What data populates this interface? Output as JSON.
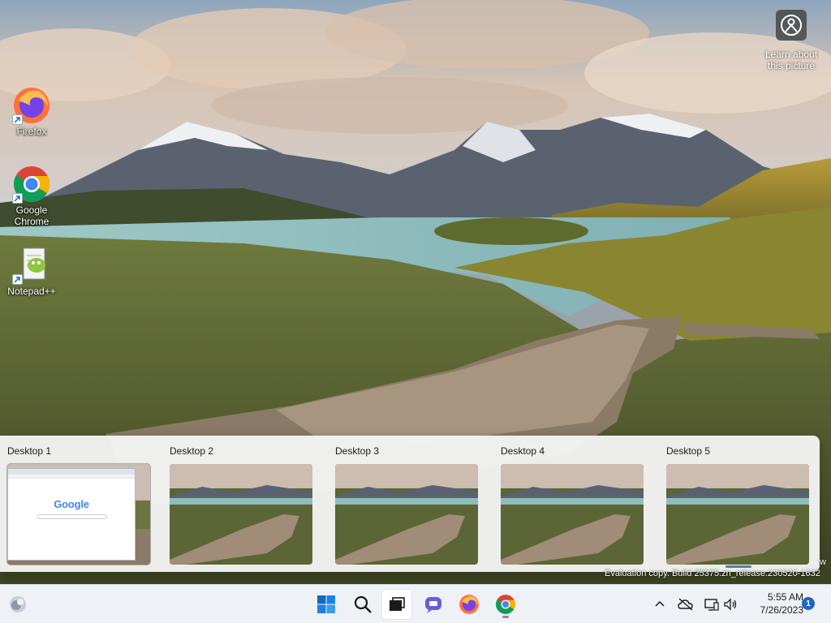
{
  "desktop": {
    "icons": [
      {
        "label": "Firefox"
      },
      {
        "label": "Google Chrome"
      },
      {
        "label": "Notepad++"
      }
    ],
    "learn_about": {
      "label": "Learn about this picture"
    }
  },
  "task_view": {
    "desktops": [
      {
        "title": "Desktop 1",
        "active": true
      },
      {
        "title": "Desktop 2"
      },
      {
        "title": "Desktop 3"
      },
      {
        "title": "Desktop 4"
      },
      {
        "title": "Desktop 5"
      }
    ],
    "desktop1_window": {
      "search_logo": "Google"
    }
  },
  "watermark": {
    "text": "Evaluation copy. Build 25375.zn_release.230520-1632",
    "edge_text": "w"
  },
  "taskbar": {
    "pinned": [
      "start-icon",
      "search-icon",
      "task-view-icon",
      "chat-icon",
      "firefox-icon",
      "chrome-icon"
    ],
    "clock": {
      "time": "5:55 AM",
      "date": "7/26/2023"
    },
    "notification_count": "1"
  },
  "colors": {
    "taskbar_bg": "#eef1f6",
    "accent": "#1f65c7",
    "panel_bg": "#f3f3f3"
  }
}
